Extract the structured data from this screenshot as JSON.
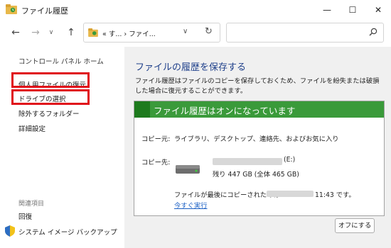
{
  "window": {
    "title": "ファイル履歴",
    "minimize_glyph": "—",
    "maximize_glyph": "☐",
    "close_glyph": "✕"
  },
  "toolbar": {
    "back_glyph": "←",
    "forward_glyph": "→",
    "recent_glyph": "∨",
    "up_glyph": "↑",
    "address_text": "« す... › ファイ...",
    "address_chevron": "∨",
    "refresh_glyph": "↻",
    "search_placeholder": ""
  },
  "sidebar": {
    "home": "コントロール パネル ホーム",
    "links": [
      "個人用ファイルの復元",
      "ドライブの選択",
      "除外するフォルダー",
      "詳細設定"
    ],
    "related_header": "関連項目",
    "restore": "回復",
    "system_image_backup": "システム イメージ バックアップ"
  },
  "main": {
    "title": "ファイルの履歴を保存する",
    "description": "ファイル履歴はファイルのコピーを保存しておくため、ファイルを紛失または破損した場合に復元することができます。",
    "status": {
      "header": "ファイル履歴はオンになっています",
      "copy_from_label": "コピー元:",
      "copy_from_value": "ライブラリ、デスクトップ、連絡先、およびお気に入り",
      "copy_to_label": "コピー先:",
      "drive_letter": "(E:)",
      "drive_space": "残り 447 GB (全体 465 GB)",
      "last_copy_prefix": "ファイルが最後にコピーされたのは",
      "last_copy_suffix": "11:43 です。",
      "run_now": "今すぐ実行"
    },
    "turn_off_button": "オフにする"
  },
  "colors": {
    "accent_blue": "#1e3f8a",
    "status_green": "#3a9a3a",
    "highlight_red": "#e0101a",
    "link_blue": "#1a5fc4"
  },
  "icons": {
    "app": "file-history-icon",
    "help": "help-icon",
    "shield": "uac-shield-icon",
    "drive": "hard-drive-icon",
    "search": "search-icon"
  }
}
